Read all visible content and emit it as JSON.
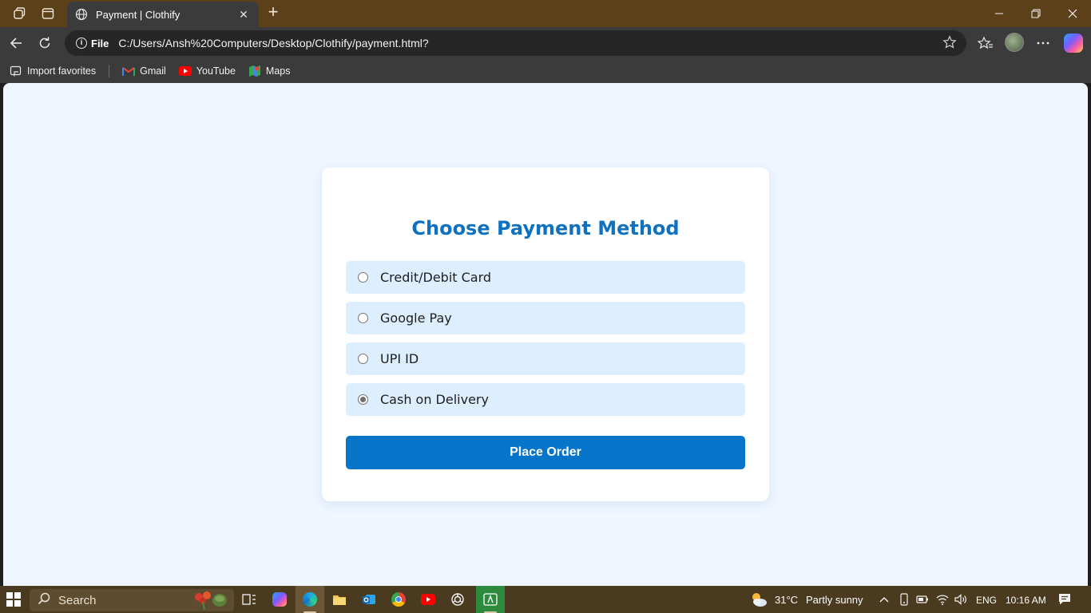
{
  "browser": {
    "tab_title": "Payment | Clothify",
    "address_chip": "File",
    "url": "C:/Users/Ansh%20Computers/Desktop/Clothify/payment.html?"
  },
  "favorites": [
    {
      "label": "Import favorites",
      "icon": "import-icon"
    },
    {
      "label": "Gmail",
      "icon": "gmail-icon"
    },
    {
      "label": "YouTube",
      "icon": "youtube-icon"
    },
    {
      "label": "Maps",
      "icon": "maps-icon"
    }
  ],
  "page": {
    "title": "Choose Payment Method",
    "options": [
      {
        "label": "Credit/Debit Card",
        "selected": false
      },
      {
        "label": "Google Pay",
        "selected": false
      },
      {
        "label": "UPI ID",
        "selected": false
      },
      {
        "label": "Cash on Delivery",
        "selected": true
      }
    ],
    "submit_label": "Place Order"
  },
  "taskbar": {
    "search_label": "Search",
    "weather_temp": "31°C",
    "weather_desc": "Partly sunny",
    "language": "ENG",
    "time": "10:16 AM"
  },
  "colors": {
    "accent": "#0674c9",
    "title": "#0f72c1",
    "page_bg": "#eff6ff",
    "option_bg": "#ddeeff"
  }
}
